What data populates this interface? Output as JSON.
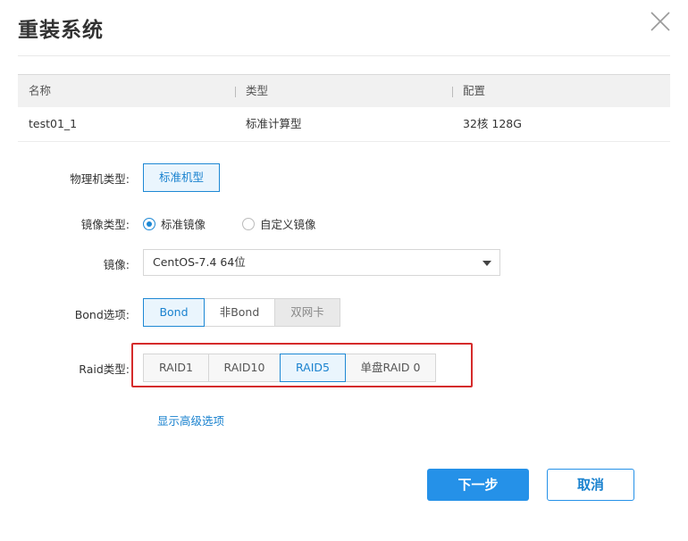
{
  "dialog": {
    "title": "重装系统",
    "close_icon": "close-icon"
  },
  "table": {
    "headers": [
      "名称",
      "类型",
      "配置"
    ],
    "rows": [
      [
        "test01_1",
        "标准计算型",
        "32核 128G"
      ]
    ]
  },
  "form": {
    "machine_type": {
      "label": "物理机类型:",
      "option": "标准机型"
    },
    "image_type": {
      "label": "镜像类型:",
      "options": [
        "标准镜像",
        "自定义镜像"
      ],
      "selected": "标准镜像"
    },
    "image": {
      "label": "镜像:",
      "value": "CentOS-7.4 64位"
    },
    "bond": {
      "label": "Bond选项:",
      "options": [
        "Bond",
        "非Bond",
        "双网卡"
      ],
      "selected": "Bond",
      "disabled": "双网卡"
    },
    "raid": {
      "label": "Raid类型:",
      "options": [
        "RAID1",
        "RAID10",
        "RAID5",
        "单盘RAID 0"
      ],
      "selected": "RAID5"
    },
    "advanced_link": "显示高级选项"
  },
  "footer": {
    "next_label": "下一步",
    "cancel_label": "取消"
  },
  "colors": {
    "accent": "#2591e8",
    "highlight_border": "#d52b2b"
  }
}
